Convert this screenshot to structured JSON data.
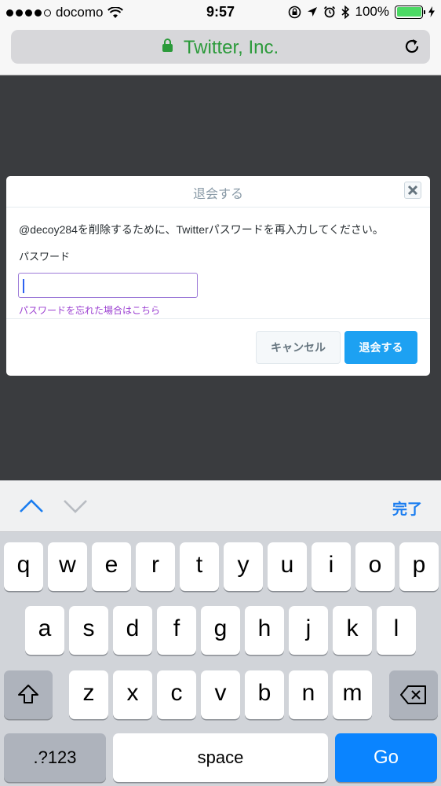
{
  "status_bar": {
    "carrier": "docomo",
    "time": "9:57",
    "battery": "100%",
    "battery_level": 1.0
  },
  "browser": {
    "site_title": "Twitter, Inc."
  },
  "dialog": {
    "title": "退会する",
    "message": "@decoy284を削除するために、Twitterパスワードを再入力してください。",
    "password_label": "パスワード",
    "password_value": "",
    "forgot_link": "パスワードを忘れた場合はこちら",
    "cancel_label": "キャンセル",
    "submit_label": "退会する"
  },
  "accessory_bar": {
    "done_label": "完了"
  },
  "keyboard": {
    "row1": [
      "q",
      "w",
      "e",
      "r",
      "t",
      "y",
      "u",
      "i",
      "o",
      "p"
    ],
    "row2": [
      "a",
      "s",
      "d",
      "f",
      "g",
      "h",
      "j",
      "k",
      "l"
    ],
    "row3": [
      "z",
      "x",
      "c",
      "v",
      "b",
      "n",
      "m"
    ],
    "numbers_label": ".?123",
    "space_label": "space",
    "go_label": "Go"
  },
  "colors": {
    "accent_blue": "#1da1f2",
    "secure_green": "#2b9a3a",
    "link_purple": "#9b3fd1",
    "ios_blue": "#0a84ff"
  },
  "icons": {
    "signal": "signal-dots-icon",
    "wifi": "wifi-icon",
    "lock": "lock-icon",
    "reload": "reload-icon",
    "close": "close-icon",
    "shift": "shift-icon",
    "backspace": "backspace-icon"
  }
}
